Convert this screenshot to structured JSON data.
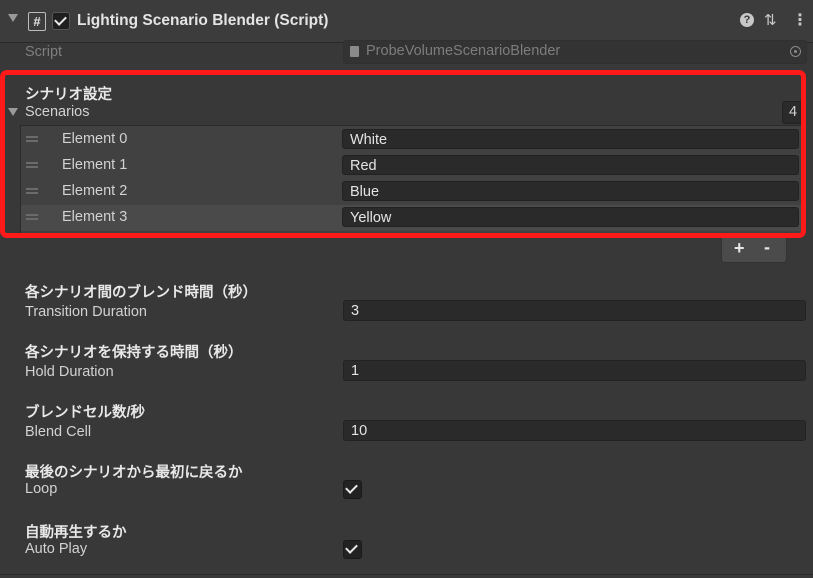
{
  "component": {
    "title": "Lighting Scenario Blender (Script)",
    "script_label": "Script",
    "script_value": "ProbeVolumeScenarioBlender",
    "icons": [
      "foldout-arrow-icon",
      "script-hash-icon",
      "check-icon",
      "help-icon",
      "preset-icon",
      "more-icon",
      "document-icon",
      "object-picker-icon"
    ]
  },
  "scenario_section": {
    "header": "シナリオ設定",
    "list_label": "Scenarios",
    "size": "4",
    "elements": [
      {
        "label": "Element 0",
        "value": "White"
      },
      {
        "label": "Element 1",
        "value": "Red"
      },
      {
        "label": "Element 2",
        "value": "Blue"
      },
      {
        "label": "Element 3",
        "value": "Yellow"
      }
    ],
    "add_label": "+",
    "remove_label": "-"
  },
  "properties": [
    {
      "header": "各シナリオ間のブレンド時間（秒）",
      "label": "Transition Duration",
      "value": "3"
    },
    {
      "header": "各シナリオを保持する時間（秒）",
      "label": "Hold Duration",
      "value": "1"
    },
    {
      "header": "ブレンドセル数/秒",
      "label": "Blend Cell",
      "value": "10"
    },
    {
      "header": "最後のシナリオから最初に戻るか",
      "label": "Loop",
      "checked": true
    },
    {
      "header": "自動再生するか",
      "label": "Auto Play",
      "checked": true
    }
  ],
  "colors": {
    "highlight": "#ff1a1a",
    "background": "#383838"
  }
}
